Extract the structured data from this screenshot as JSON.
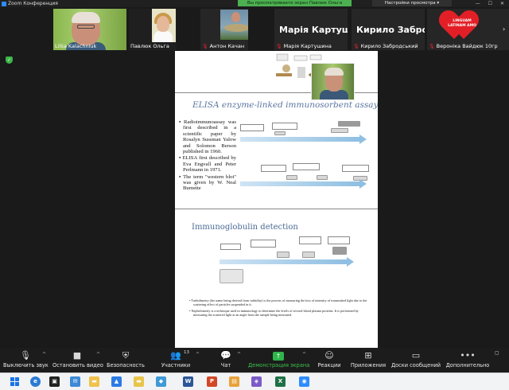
{
  "window": {
    "title": "Zoom Конференция",
    "controls": "— ☐ ✕"
  },
  "share_banner": {
    "text": "Вы просматриваете экран Павлюк Ольга",
    "options_label": "Настройки просмотра ▾"
  },
  "participants": [
    {
      "name": "Liliia Kalachniuk",
      "muted": false
    },
    {
      "name": "Павлюк Ольга",
      "muted": false
    },
    {
      "name": "Антон Качан",
      "muted": true
    },
    {
      "name": "Марія Картушина",
      "big": "Марія Картушин...",
      "muted": true
    },
    {
      "name": "Кирило Забродський",
      "big": "Кирило Забродь...",
      "muted": true
    },
    {
      "name": "Вероніка Вайдюк 10гр",
      "muted": true,
      "logo_text": "LINGUAM LATINAM AMO"
    }
  ],
  "slide1": {
    "title": "ELISA enzyme-linked immunosorbent assay",
    "bullets": [
      "Radioimmunoassay was first described in a scientific paper by Rosalyn Sussman Yalow and Solomon Berson published in 1960.",
      "ELISA first described by Eva Engvall and Peter Perlmann in 1971.",
      "The term \"western blot\" was given by W. Neal Burnette"
    ]
  },
  "slide2": {
    "title": "Immunoglobulin detection",
    "bullets": [
      "Turbidimetry (the name being derived from turbidity) is the process of measuring the loss of intensity of transmitted light due to the scattering effect of particles suspended in it.",
      "Nephelometry is a technique used in immunology to determine the levels of several blood plasma proteins. It is performed by measuring the scattered light at an angle from the sample being measured."
    ]
  },
  "toolbar": {
    "mute": "Выключить звук",
    "video": "Остановить видео",
    "security": "Безопасность",
    "participants": "Участники",
    "participants_count": "13",
    "chat": "Чат",
    "share": "Демонстрация экрана",
    "reactions": "Реакции",
    "apps": "Приложения",
    "whiteboard": "Доски сообщений",
    "more": "Дополнительно"
  },
  "colors": {
    "share_green": "#4cb050",
    "toolbar_bg": "#1c1c1c",
    "slide_title": "#5b76a0"
  }
}
